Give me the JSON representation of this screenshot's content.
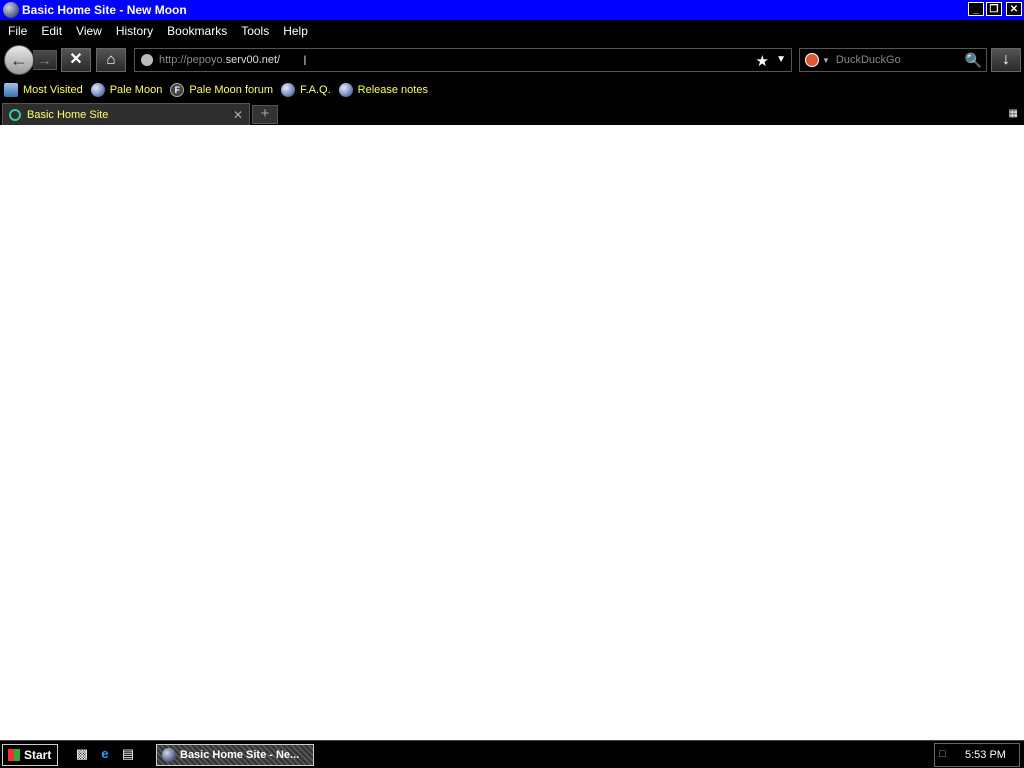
{
  "window": {
    "title": "Basic Home Site - New Moon",
    "minimize": "_",
    "restore": "❐",
    "close": "✕"
  },
  "menu": [
    "File",
    "Edit",
    "View",
    "History",
    "Bookmarks",
    "Tools",
    "Help"
  ],
  "nav": {
    "url_prefix": "http://pepoyo.",
    "url_host": "serv00.net/",
    "search_placeholder": "DuckDuckGo"
  },
  "bookmarks": [
    {
      "label": "Most Visited",
      "icon": "most-visited-icon"
    },
    {
      "label": "Pale Moon",
      "icon": "pale-moon-icon"
    },
    {
      "label": "Pale Moon forum",
      "icon": "forum-icon"
    },
    {
      "label": "F.A.Q.",
      "icon": "pale-moon-icon"
    },
    {
      "label": "Release notes",
      "icon": "pale-moon-icon"
    }
  ],
  "tabs": [
    {
      "label": "Basic Home Site"
    }
  ],
  "taskbar": {
    "start_label": "Start",
    "task_label": "Basic Home Site - Ne...",
    "clock": "5:53 PM"
  }
}
